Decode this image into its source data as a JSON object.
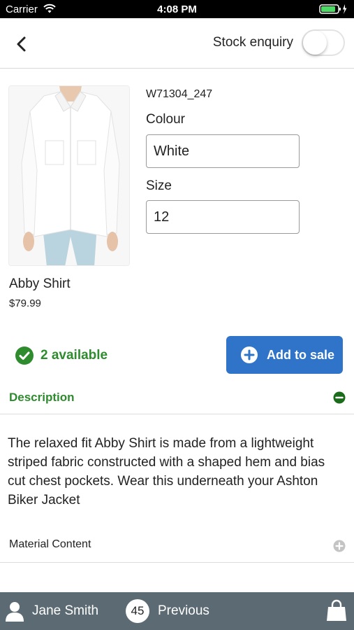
{
  "status_bar": {
    "carrier": "Carrier",
    "time": "4:08 PM"
  },
  "nav": {
    "stock_enquiry_label": "Stock enquiry",
    "stock_enquiry_on": false
  },
  "product": {
    "name": "Abby Shirt",
    "price": "$79.99",
    "sku": "W71304_247",
    "colour_label": "Colour",
    "colour_value": "White",
    "size_label": "Size",
    "size_value": "12"
  },
  "availability": {
    "text": "2 available"
  },
  "actions": {
    "add_to_sale": "Add to sale"
  },
  "description": {
    "title": "Description",
    "body": "The relaxed fit Abby Shirt is made from a lightweight striped fabric constructed with a shaped hem and bias cut chest pockets. Wear this underneath your Ashton Biker Jacket"
  },
  "material": {
    "title": "Material Content"
  },
  "bottom_bar": {
    "user_name": "Jane Smith",
    "count": "45",
    "previous_label": "Previous"
  },
  "colors": {
    "accent_green": "#2e8b2e",
    "button_blue": "#2f74c9",
    "bottom_bar": "#5b6a73"
  },
  "icons": [
    "wifi-icon",
    "battery-icon",
    "back-chevron-icon",
    "check-circle-icon",
    "plus-circle-icon",
    "minus-circle-icon",
    "user-icon",
    "shopping-bag-icon"
  ]
}
